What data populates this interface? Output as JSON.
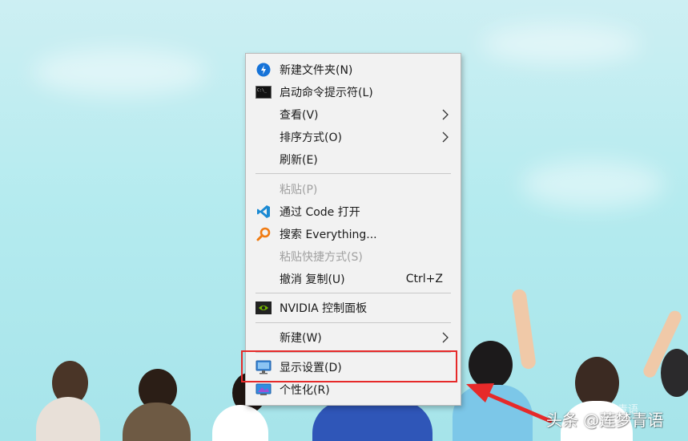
{
  "menu": {
    "items": [
      {
        "name": "new-folder",
        "label": "新建文件夹(N)",
        "icon": "lightning-icon",
        "enabled": true
      },
      {
        "name": "open-cmd",
        "label": "启动命令提示符(L)",
        "icon": "terminal-icon",
        "enabled": true
      },
      {
        "name": "view",
        "label": "查看(V)",
        "submenu": true,
        "enabled": true
      },
      {
        "name": "sort-by",
        "label": "排序方式(O)",
        "submenu": true,
        "enabled": true
      },
      {
        "name": "refresh",
        "label": "刷新(E)",
        "enabled": true
      },
      {
        "name": "paste",
        "label": "粘贴(P)",
        "enabled": false
      },
      {
        "name": "open-with-code",
        "label": "通过 Code 打开",
        "icon": "vscode-icon",
        "enabled": true
      },
      {
        "name": "search-everything",
        "label": "搜索 Everything...",
        "icon": "magnifier-icon",
        "enabled": true
      },
      {
        "name": "paste-shortcut",
        "label": "粘贴快捷方式(S)",
        "enabled": false
      },
      {
        "name": "undo-copy",
        "label": "撤消 复制(U)",
        "shortcut": "Ctrl+Z",
        "enabled": true
      },
      {
        "name": "nvidia-control-panel",
        "label": "NVIDIA 控制面板",
        "icon": "nvidia-icon",
        "enabled": true
      },
      {
        "name": "new",
        "label": "新建(W)",
        "submenu": true,
        "enabled": true
      },
      {
        "name": "display-settings",
        "label": "显示设置(D)",
        "icon": "monitor-icon",
        "enabled": true
      },
      {
        "name": "personalize",
        "label": "个性化(R)",
        "icon": "personalize-icon",
        "enabled": true
      }
    ]
  },
  "annotation": {
    "highlight_color": "#e62a2a",
    "arrow_color": "#e62a2a"
  },
  "watermark": {
    "text": "头条 @莲梦青语",
    "ghost_text": "莲梦青语"
  }
}
